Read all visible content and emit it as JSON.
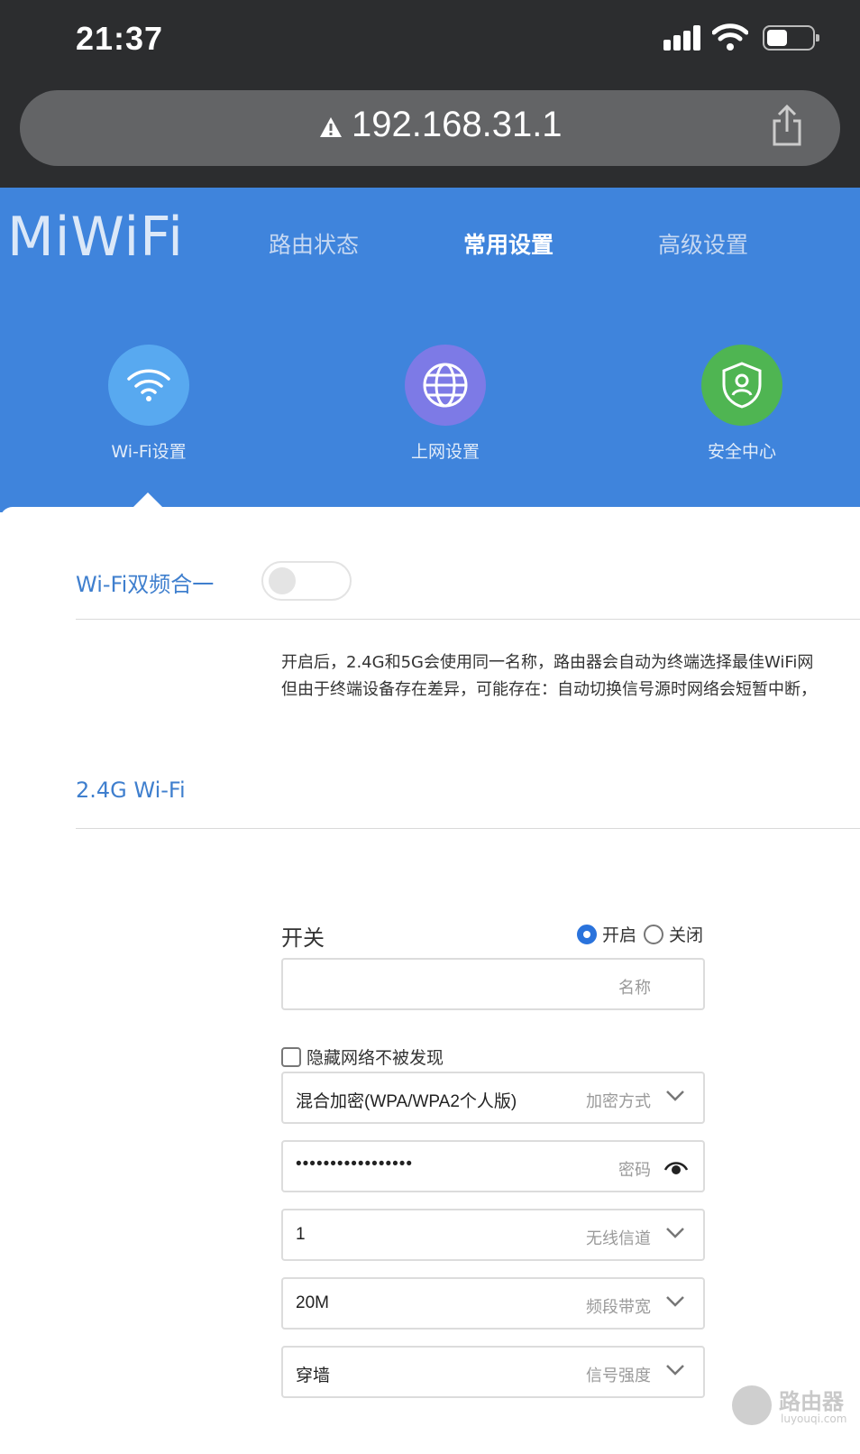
{
  "status_bar": {
    "time": "21:37"
  },
  "browser": {
    "url": "192.168.31.1"
  },
  "header": {
    "logo": "MiWiFi",
    "nav": [
      {
        "label": "路由状态"
      },
      {
        "label": "常用设置",
        "active": true
      },
      {
        "label": "高级设置"
      }
    ],
    "categories": [
      {
        "label": "Wi-Fi设置",
        "icon": "wifi-icon",
        "color": "#58a9f0"
      },
      {
        "label": "上网设置",
        "icon": "globe-icon",
        "color": "#7d7ae6"
      },
      {
        "label": "安全中心",
        "icon": "shield-icon",
        "color": "#4fb552"
      }
    ]
  },
  "dual_band": {
    "title": "Wi-Fi双频合一",
    "enabled": false,
    "desc_line1": "开启后，2.4G和5G会使用同一名称，路由器会自动为终端选择最佳WiFi网",
    "desc_line2": "但由于终端设备存在差异，可能存在：自动切换信号源时网络会短暂中断，"
  },
  "wifi24": {
    "title": "2.4G Wi-Fi",
    "switch_label": "开关",
    "radio_on": "开启",
    "radio_off": "关闭",
    "switch_state": "on",
    "name_value": "",
    "name_placeholder": "名称",
    "hide_network_label": "隐藏网络不被发现",
    "encryption_value": "混合加密(WPA/WPA2个人版)",
    "encryption_label": "加密方式",
    "password_value": "•••••••••••••••••",
    "password_label": "密码",
    "channel_value": "1",
    "channel_label": "无线信道",
    "bandwidth_value": "20M",
    "bandwidth_label": "频段带宽",
    "signal_value": "穿墙",
    "signal_label": "信号强度"
  },
  "watermark": {
    "text": "路由器",
    "sub": "luyouqi.com"
  }
}
